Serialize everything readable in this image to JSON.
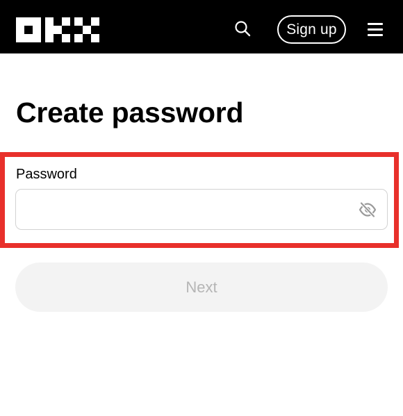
{
  "header": {
    "logo_icon": "okx-logo",
    "search_icon": "search-icon",
    "signup_label": "Sign up",
    "menu_icon": "hamburger-menu-icon",
    "background_color": "#000000"
  },
  "main": {
    "title": "Create password",
    "password": {
      "label": "Password",
      "value": "",
      "toggle_icon": "eye-off-icon"
    },
    "next_label": "Next"
  },
  "colors": {
    "highlight": "#e8302b",
    "disabled_button_bg": "#f3f3f3",
    "disabled_button_text": "#b5b5b5"
  }
}
